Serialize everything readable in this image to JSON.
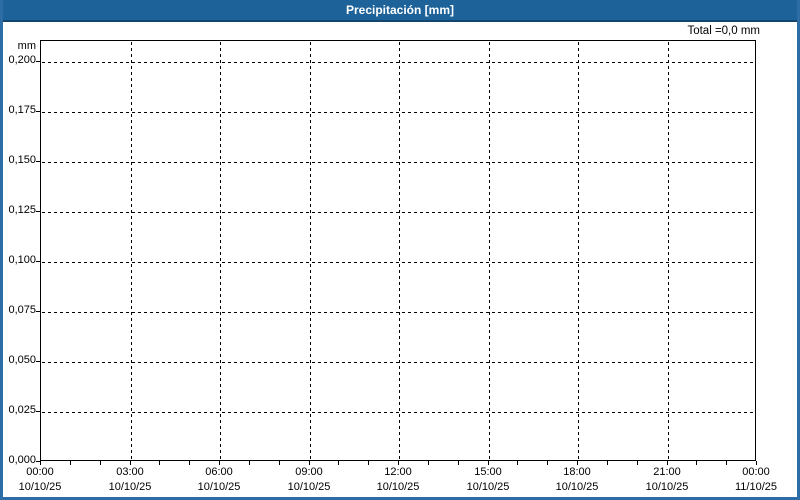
{
  "window": {
    "title": "Precipitación [mm]",
    "title_bg": "#1d6298",
    "title_text_color": "#ffffff",
    "titlebar_underline_color": "#14456f",
    "border_color": "#2d6da6",
    "background": "#ffffff"
  },
  "chart_data": {
    "type": "line",
    "title": "Precipitación [mm]",
    "total_label": "Total =0,0 mm",
    "total_precipitation_mm": 0.0,
    "series": [
      {
        "name": "Precipitación",
        "unit": "mm",
        "values": []
      }
    ],
    "grid": true,
    "grid_style": "dashed",
    "grid_color": "#000000",
    "axis_color": "#000000",
    "legend": false,
    "y_axis": {
      "unit": "mm",
      "min": 0.0,
      "max": 0.2,
      "step": 0.025,
      "tick_labels": [
        "0,000",
        "0,025",
        "0,050",
        "0,075",
        "0,100",
        "0,125",
        "0,150",
        "0,175",
        "0,200"
      ]
    },
    "x_axis": {
      "start": "10/10/25 00:00",
      "end": "11/10/25 00:00",
      "span_hours": 24,
      "minor_tick_hours": 1,
      "major_tick_hours": 3,
      "ticks": [
        {
          "time": "00:00",
          "date": "10/10/25"
        },
        {
          "time": "03:00",
          "date": "10/10/25"
        },
        {
          "time": "06:00",
          "date": "10/10/25"
        },
        {
          "time": "09:00",
          "date": "10/10/25"
        },
        {
          "time": "12:00",
          "date": "10/10/25"
        },
        {
          "time": "15:00",
          "date": "10/10/25"
        },
        {
          "time": "18:00",
          "date": "10/10/25"
        },
        {
          "time": "21:00",
          "date": "10/10/25"
        },
        {
          "time": "00:00",
          "date": "11/10/25"
        }
      ]
    }
  }
}
